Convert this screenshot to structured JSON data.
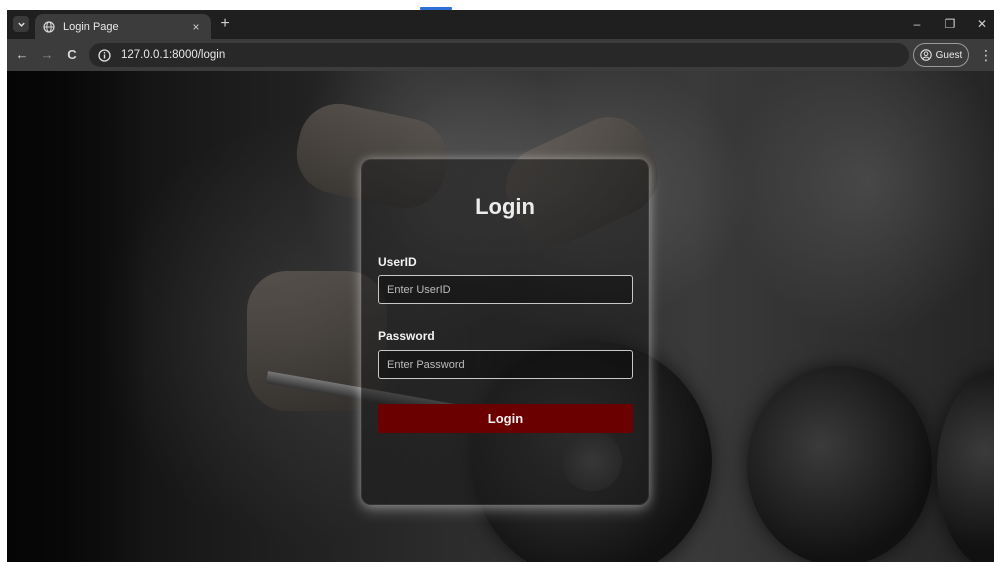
{
  "browser": {
    "tab_title": "Login Page",
    "tab_close_glyph": "×",
    "new_tab_glyph": "+",
    "url": "127.0.0.1:8000/login",
    "profile_label": "Guest",
    "back_glyph": "←",
    "forward_glyph": "→",
    "reload_glyph": "C",
    "menu_glyph": "⋮",
    "minimize_glyph": "–",
    "restore_glyph": "❐",
    "close_glyph": "✕",
    "accent_color": "#2c6fd6"
  },
  "login": {
    "title": "Login",
    "userid_label": "UserID",
    "userid_placeholder": "Enter UserID",
    "password_label": "Password",
    "password_placeholder": "Enter Password",
    "submit_label": "Login",
    "button_color": "#6b0000"
  }
}
